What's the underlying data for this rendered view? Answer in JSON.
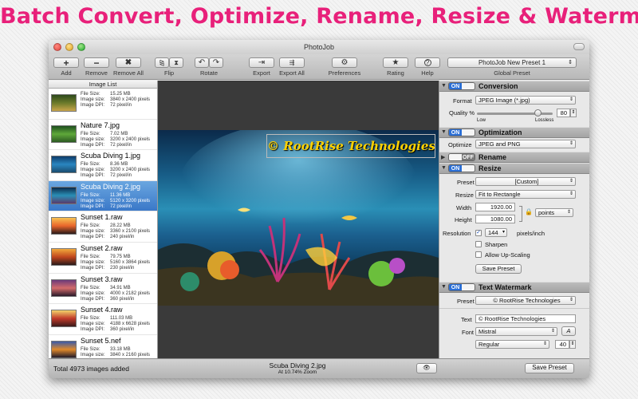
{
  "promo_headline": "Batch Convert, Optimize, Rename, Resize & Watermark your photos",
  "window": {
    "title": "PhotoJob"
  },
  "toolbar": {
    "add": "Add",
    "remove": "Remove",
    "remove_all": "Remove All",
    "flip": "Flip",
    "rotate": "Rotate",
    "export": "Export",
    "export_all": "Export All",
    "preferences": "Preferences",
    "rating": "Rating",
    "help": "Help",
    "preset_value": "PhotoJob New Preset 1",
    "global_preset": "Global Preset"
  },
  "sidebar": {
    "header": "Image List",
    "meta_labels": {
      "file_size": "File Size:",
      "image_size": "Image size:",
      "image_dpi": "Image DPI:"
    },
    "items": [
      {
        "name": "",
        "file_size": "15.25 MB",
        "image_size": "3840 x 2400 pixels",
        "dpi": "72 pixel/in"
      },
      {
        "name": "Nature 7.jpg",
        "file_size": "7.02 MB",
        "image_size": "3200 x 2400 pixels",
        "dpi": "72 pixel/in"
      },
      {
        "name": "Scuba Diving 1.jpg",
        "file_size": "8.36 MB",
        "image_size": "3200 x 2400 pixels",
        "dpi": "72 pixel/in"
      },
      {
        "name": "Scuba Diving 2.jpg",
        "file_size": "11.36 MB",
        "image_size": "5120 x 3200 pixels",
        "dpi": "72 pixel/in"
      },
      {
        "name": "Sunset 1.raw",
        "file_size": "28.22 MB",
        "image_size": "3360 x 2100 pixels",
        "dpi": "240 pixel/in"
      },
      {
        "name": "Sunset 2.raw",
        "file_size": "79.75 MB",
        "image_size": "5160 x 3864 pixels",
        "dpi": "230 pixel/in"
      },
      {
        "name": "Sunset 3.raw",
        "file_size": "34.91 MB",
        "image_size": "4000 x 2182 pixels",
        "dpi": "360 pixel/in"
      },
      {
        "name": "Sunset 4.raw",
        "file_size": "111.03 MB",
        "image_size": "4188 x 6628 pixels",
        "dpi": "360 pixel/in"
      },
      {
        "name": "Sunset 5.nef",
        "file_size": "33.18 MB",
        "image_size": "3840 x 2160 pixels",
        "dpi": "72 pixel/in"
      }
    ],
    "selected_index": 3
  },
  "preview": {
    "watermark_text": "© RootRise Technologies",
    "filename": "Scuba Diving 2.jpg",
    "zoom_text": "At 10.74% Zoom"
  },
  "panel": {
    "on": "ON",
    "off": "OFF",
    "conversion": {
      "title": "Conversion",
      "format_label": "Format",
      "format_value": "JPEG Image (*.jpg)",
      "quality_label": "Quality %",
      "quality_value": "80",
      "quality_fraction": 0.8,
      "low": "Low",
      "lossless": "Lossless"
    },
    "optimization": {
      "title": "Optimization",
      "optimize_label": "Optimize",
      "optimize_value": "JPEG and PNG"
    },
    "rename": {
      "title": "Rename"
    },
    "resize": {
      "title": "Resize",
      "preset_label": "Preset",
      "preset_value": "[Custom]",
      "resize_label": "Resize",
      "resize_value": "Fit to Rectangle",
      "width_label": "Width",
      "width_value": "1920.00",
      "height_label": "Height",
      "height_value": "1080.00",
      "unit_value": "points",
      "resolution_label": "Resolution",
      "resolution_value": "144",
      "resolution_unit": "pixels/inch",
      "sharpen": "Sharpen",
      "allow_upscaling": "Allow Up-Scaling",
      "save_preset": "Save Preset"
    },
    "watermark": {
      "title": "Text Watermark",
      "preset_label": "Preset",
      "preset_value": "© RootRise Technologies",
      "text_label": "Text",
      "text_value": "© RootRise Technologies",
      "font_label": "Font",
      "font_value": "Mistral",
      "style_value": "Regular",
      "size_value": "40"
    }
  },
  "bottom": {
    "total": "Total 4973 images added",
    "save_preset": "Save Preset"
  }
}
